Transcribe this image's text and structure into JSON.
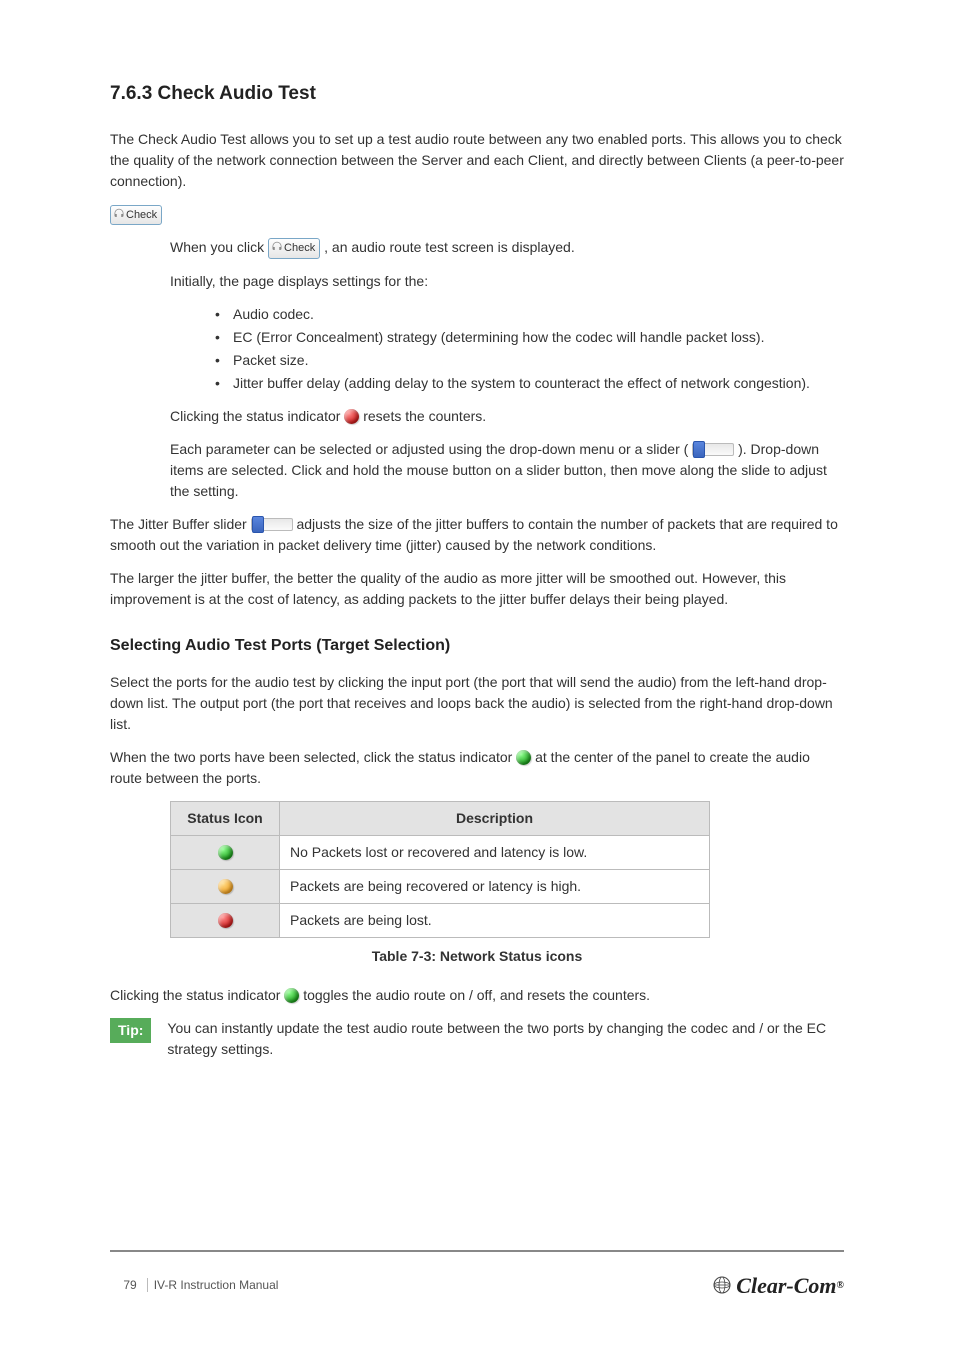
{
  "section": {
    "heading": "7.6.3 Check Audio Test",
    "intro1": "The Check Audio Test allows you to set up a test audio route between any two enabled ports. This allows you to check the quality of the network connection between the Server and each Client, and directly between Clients (a peer-to-peer connection).",
    "intro2_pre": "When you click ",
    "intro2_post": ", an audio route test screen is displayed.",
    "bullets_intro": "Initially, the page displays settings for the:",
    "bullets": [
      "Audio codec.",
      "EC (Error Concealment) strategy (determining how the codec will handle packet loss).",
      "Packet size.",
      "Jitter buffer delay (adding delay to the system to counteract the effect of network congestion)."
    ],
    "para3_pre": "Each parameter can be selected or adjusted using the drop-down menu or a slider (",
    "para3_post": "). Drop-down items are selected. Click and hold the mouse button on a slider button, then move along the slide to adjust the setting.",
    "para4_pre": "The Jitter Buffer slider",
    "para4_post": " adjusts the size of the jitter buffers to contain the number of packets that are required to smooth out the variation in packet delivery time (jitter) caused by the network conditions.",
    "para5": "The larger the jitter buffer, the better the quality of the audio as more jitter will be smoothed out. However, this improvement is at the cost of latency, as adding packets to the jitter buffer delays their being played.",
    "target": {
      "heading": "Selecting Audio Test Ports (Target Selection)",
      "para1": "Select the ports for the audio test by clicking the input port (the port that will send the audio) from the left-hand drop-down list. The output port (the port that receives and loops back the audio) is selected from the right-hand drop-down list.",
      "para2_pre": "When the two ports have been selected, click the status indicator ",
      "para2_post": " at the center of the panel to create the audio route between the ports.",
      "table": {
        "h1": "Status Icon",
        "h2": "Description",
        "rows": [
          {
            "icon": "green",
            "desc": "No Packets lost or recovered and latency is low."
          },
          {
            "icon": "orange",
            "desc": "Packets are being recovered or latency is high."
          },
          {
            "icon": "red",
            "desc": "Packets are being lost."
          }
        ]
      },
      "table_caption": "Table 7-3: Network Status icons",
      "para3_pre": "Clicking the status indicator ",
      "para3_post": " toggles the audio route on / off, and resets the counters.",
      "tip_label": "Tip:",
      "tip_text": "You can instantly update the test audio route between the two ports by changing the codec and / or the EC strategy settings."
    },
    "check_label": "Check",
    "status_red_name": "red-status-icon",
    "status_green_name": "green-status-icon"
  },
  "footer": {
    "page": "79",
    "line1": "IV-R Instruction Manual",
    "brand": "Clear-Com"
  }
}
